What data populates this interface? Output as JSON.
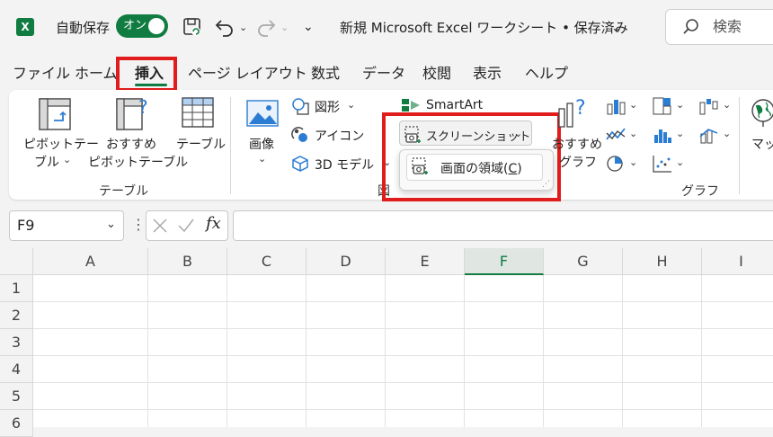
{
  "titlebar": {
    "autosave_label": "自動保存",
    "autosave_toggle": "オン",
    "doc_title": "新規 Microsoft Excel ワークシート • 保存済み",
    "search_placeholder": "検索"
  },
  "tabs": [
    "ファイル",
    "ホーム",
    "挿入",
    "ページ レイアウト",
    "数式",
    "データ",
    "校閲",
    "表示",
    "ヘルプ"
  ],
  "active_tab": "挿入",
  "ribbon": {
    "pivot_table": [
      "ピボットテー",
      "ブル"
    ],
    "recommended_pivot": [
      "おすすめ",
      "ピボットテーブル"
    ],
    "table": "テーブル",
    "group_table": "テーブル",
    "image": "画像",
    "shapes": "図形",
    "icons": "アイコン",
    "model3d": "3D モデル",
    "smartart": "SmartArt",
    "screenshot": "スクリーンショット",
    "group_illustration_partial": "図",
    "recommended_chart": [
      "おすすめ",
      "グラフ"
    ],
    "group_charts": "グラフ",
    "maps_partial": "マッ"
  },
  "screenshot_menu": {
    "item": "画面の領域(C)",
    "item_text": "画面の領域(",
    "item_key": "C",
    "item_close": ")"
  },
  "formula_bar": {
    "name_box": "F9",
    "fx": "fx",
    "value": ""
  },
  "grid": {
    "columns": [
      "A",
      "B",
      "C",
      "D",
      "E",
      "F",
      "G",
      "H",
      "I"
    ],
    "selected_column": "F",
    "rows": [
      "1",
      "2",
      "3",
      "4",
      "5",
      "6"
    ]
  },
  "colors": {
    "accent": "#107c41",
    "highlight": "#e01c1c"
  }
}
